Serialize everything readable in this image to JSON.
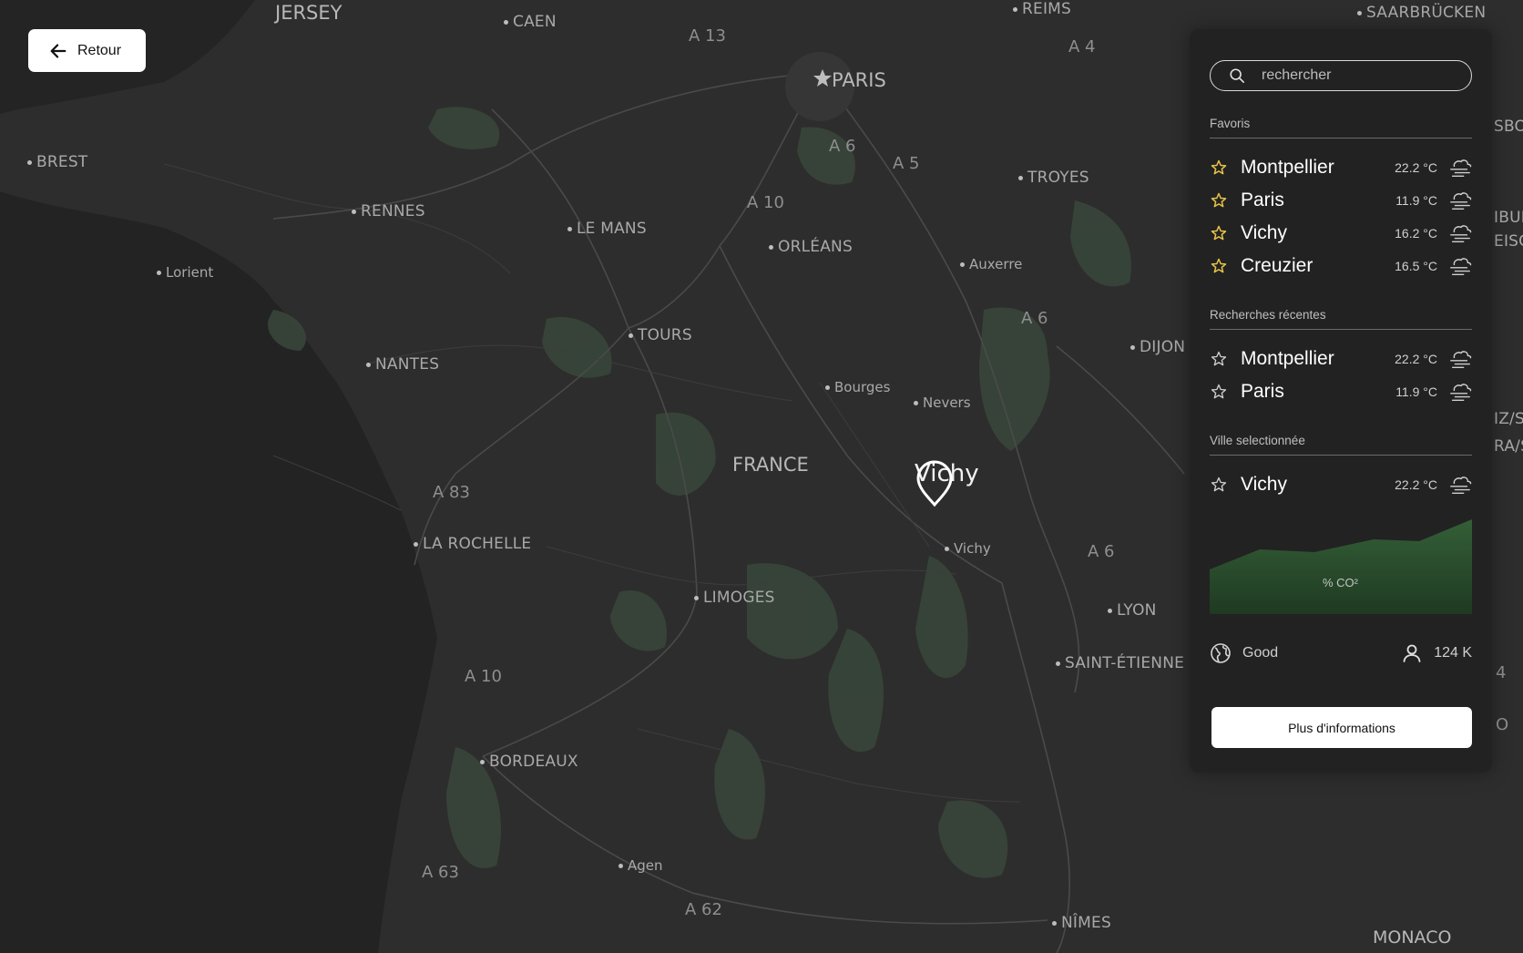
{
  "back_button": {
    "label": "Retour",
    "icon": "arrow-left-icon"
  },
  "map": {
    "selected_pin": "Vichy",
    "labels": {
      "jersey": "JERSEY",
      "caen": "CAEN",
      "reims": "REIMS",
      "saarbrucken": "SAARBRÜCKEN",
      "a13": "A 13",
      "a4": "A 4",
      "paris": "PARIS",
      "brest": "BREST",
      "a6_north": "A 6",
      "a5": "A 5",
      "troyes": "TROYES",
      "rennes": "RENNES",
      "a10_north": "A 10",
      "le_mans": "LE MANS",
      "orleans": "ORLÉANS",
      "lorient": "Lorient",
      "auxerre": "Auxerre",
      "a6_mid": "A 6",
      "tours": "TOURS",
      "dijon": "DIJON",
      "nantes": "NANTES",
      "bourges": "Bourges",
      "nevers": "Nevers",
      "france": "FRANCE",
      "a83": "A 83",
      "la_rochelle": "LA ROCHELLE",
      "vichy": "Vichy",
      "a6_south": "A 6",
      "limoges": "LIMOGES",
      "lyon": "LYON",
      "a10_south": "A 10",
      "saint_etienne": "SAINT-ÉTIENNE",
      "bordeaux": "BORDEAUX",
      "agen": "Agen",
      "a63": "A 63",
      "a62": "A 62",
      "nimes": "NÎMES",
      "monaco": "MONACO",
      "edge_sbo": "SBO",
      "edge_ibur": "IBUR",
      "edge_eisga": "EISGA",
      "edge_iz": "IZ/S",
      "edge_ra": "RA/S",
      "edge_4": "4",
      "edge_o": "O"
    }
  },
  "search": {
    "placeholder": "rechercher",
    "value": "",
    "icon": "search-icon"
  },
  "favorites": {
    "title": "Favoris",
    "items": [
      {
        "name": "Montpellier",
        "temp": "22.2 °C",
        "icon": "cloud-wind-icon"
      },
      {
        "name": "Paris",
        "temp": "11.9 °C",
        "icon": "cloud-wind-icon"
      },
      {
        "name": "Vichy",
        "temp": "16.2 °C",
        "icon": "cloud-wind-icon"
      },
      {
        "name": "Creuzier",
        "temp": "16.5 °C",
        "icon": "cloud-wind-icon"
      }
    ]
  },
  "recent": {
    "title": "Recherches récentes",
    "items": [
      {
        "name": "Montpellier",
        "temp": "22.2 °C",
        "icon": "cloud-wind-icon"
      },
      {
        "name": "Paris",
        "temp": "11.9 °C",
        "icon": "cloud-wind-icon"
      }
    ]
  },
  "selected": {
    "title": "Ville selectionnée",
    "city": {
      "name": "Vichy",
      "temp": "22.2 °C",
      "icon": "cloud-wind-icon"
    },
    "chart_label": "% CO²",
    "air_quality": "Good",
    "population": "124 K",
    "more_button": "Plus d'informations"
  },
  "colors": {
    "map_background": "#2c2c2c",
    "sea": "#222222",
    "forest": "#3b4a37",
    "panel": "#222222",
    "favorite_star": "#e8c547",
    "chart_fill": "#2f5a33"
  }
}
